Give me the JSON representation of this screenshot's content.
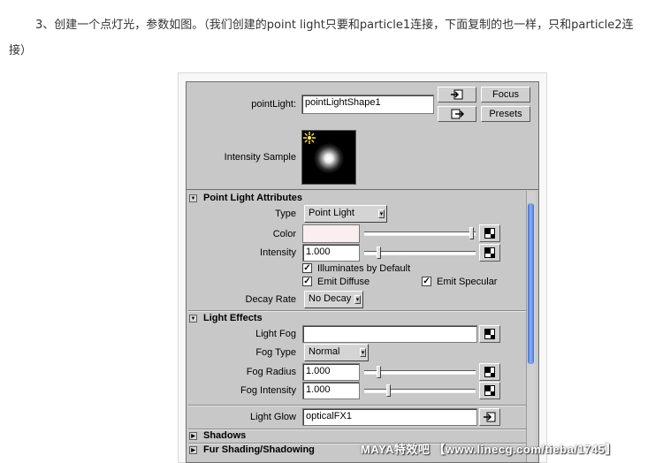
{
  "intro": {
    "line1": "3、创建一个点灯光，参数如图。（我们创建的point   light只要和particle1连接，下面复制的也一样，只和particle2连",
    "line2": "接）"
  },
  "header": {
    "node_label": "pointLight:",
    "node_value": "pointLightShape1",
    "focus_label": "Focus",
    "presets_label": "Presets",
    "intensity_sample_label": "Intensity Sample"
  },
  "sections": {
    "point_light": {
      "title": "Point Light Attributes",
      "type_label": "Type",
      "type_value": "Point Light",
      "color_label": "Color",
      "color_value": "#fbeef0",
      "intensity_label": "Intensity",
      "intensity_value": "1.000",
      "illuminates_label": "Illuminates by Default",
      "emit_diffuse_label": "Emit Diffuse",
      "emit_specular_label": "Emit Specular",
      "checked": true,
      "decay_label": "Decay Rate",
      "decay_value": "No Decay"
    },
    "light_effects": {
      "title": "Light Effects",
      "fog_label": "Light Fog",
      "fog_value": "",
      "fog_type_label": "Fog Type",
      "fog_type_value": "Normal",
      "fog_radius_label": "Fog Radius",
      "fog_radius_value": "1.000",
      "fog_intensity_label": "Fog Intensity",
      "fog_intensity_value": "1.000",
      "glow_label": "Light Glow",
      "glow_value": "opticalFX1"
    },
    "shadows": {
      "title": "Shadows"
    },
    "mental_ray": {
      "title": "Fur Shading/Shadowing"
    }
  },
  "watermark": "MAYA特效吧 【www.linecg.com/tieba/1745】",
  "icons": {
    "expanded": "expand-triangle-icon",
    "collapsed": "collapse-triangle-icon",
    "map": "checker-map-icon",
    "input": "connection-input-icon",
    "output": "connection-output-icon"
  }
}
